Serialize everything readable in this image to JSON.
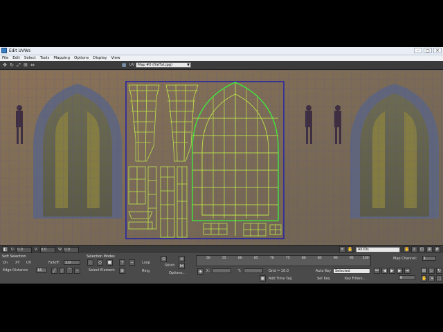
{
  "window": {
    "title": "Edit UVWs",
    "controls": [
      "–",
      "□",
      "✕"
    ]
  },
  "menu": [
    "File",
    "Edit",
    "Select",
    "Tools",
    "Mapping",
    "Options",
    "Display",
    "View"
  ],
  "toolbar": {
    "uv_label": "UV",
    "map_dropdown": "Map #0 (fileTxt.jpg)"
  },
  "status": {
    "u_label": "U:",
    "v_label": "V:",
    "w_label": "W:",
    "u_value": "0.0",
    "v_value": "0.0",
    "w_value": "0.0",
    "id_filter": "All IDs"
  },
  "soft_selection": {
    "title": "Soft Selection",
    "on_label": "On",
    "xy_label": "XY",
    "uv_label": "UV",
    "falloff_label": "Falloff:",
    "falloff_value": "1.0",
    "edge_distance_label": "Edge Distance",
    "edge_distance_value": "16"
  },
  "selection_modes": {
    "title": "Selection Modes",
    "loop_label": "Loop",
    "ring_label": "Ring",
    "select_element_label": "Select Element"
  },
  "stitch": {
    "stitch_label": "Stitch",
    "options_label": "Options..."
  },
  "timeline": {
    "ticks": [
      "50",
      "55",
      "60",
      "65",
      "70",
      "75",
      "80",
      "85",
      "90",
      "95",
      "100"
    ]
  },
  "coords": {
    "x_label": "X:",
    "y_label": "Y:",
    "grid_label": "Grid = 10.0",
    "add_time_tag": "Add Time Tag"
  },
  "anim": {
    "auto_key": "Auto Key",
    "set_key": "Set Key",
    "selected": "Selected",
    "key_filters": "Key Filters...",
    "frame": "0"
  },
  "map_channel": {
    "label": "Map Channel:",
    "value": "1"
  },
  "colors": {
    "wire": "#bfe84a",
    "wire_outline": "#3cf03c",
    "frame": "#1b1bb0",
    "grid": "#4a4aa0"
  }
}
